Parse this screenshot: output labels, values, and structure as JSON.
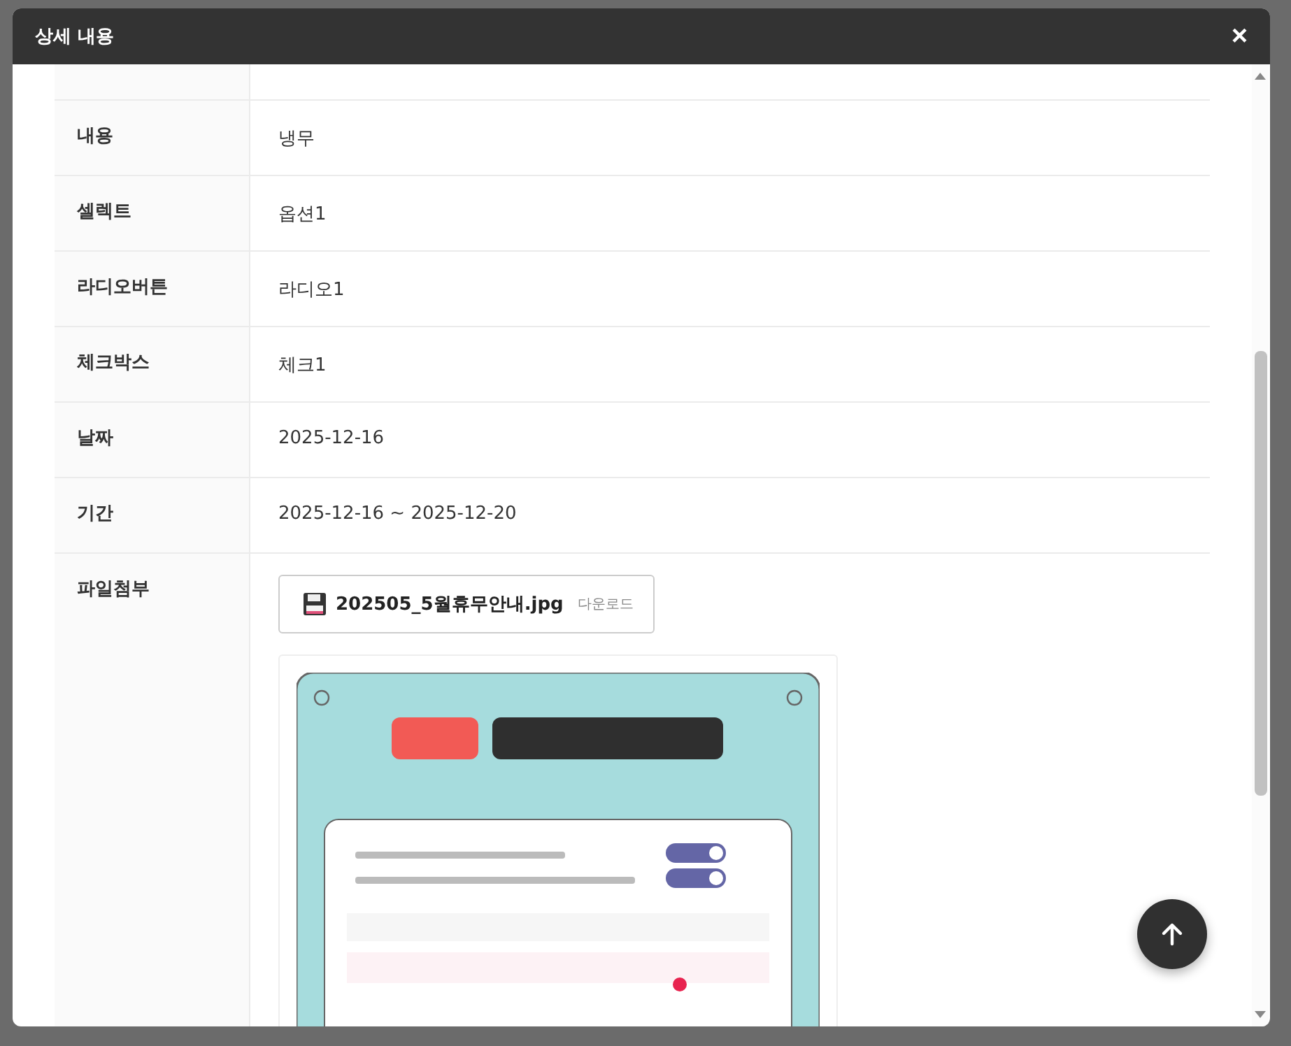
{
  "modal": {
    "title": "상세 내용",
    "close": "×"
  },
  "rows": [
    {
      "kind": "text",
      "label": "내용",
      "value": "냉무"
    },
    {
      "kind": "text",
      "label": "셀렉트",
      "value": "옵션1"
    },
    {
      "kind": "text",
      "label": "라디오버튼",
      "value": "라디오1"
    },
    {
      "kind": "text",
      "label": "체크박스",
      "value": "체크1"
    },
    {
      "kind": "text",
      "label": "날짜",
      "value": "2025-12-16"
    },
    {
      "kind": "text",
      "label": "기간",
      "value": "2025-12-16 ~ 2025-12-20"
    },
    {
      "kind": "file",
      "label": "파일첨부",
      "file_name": "202505_5월휴무안내.jpg",
      "download": "다운로드"
    }
  ]
}
